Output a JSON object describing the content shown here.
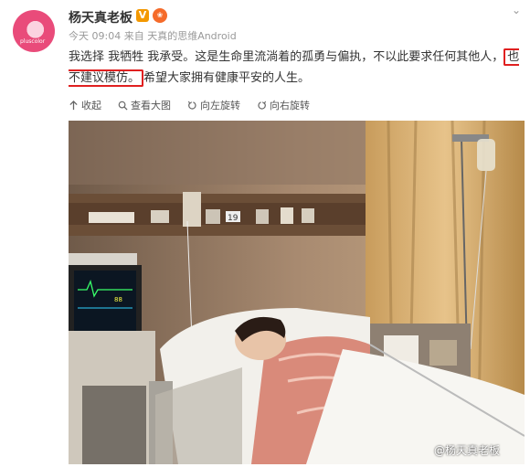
{
  "post": {
    "username": "杨天真老板",
    "vip_badge": "V",
    "meta": "今天 09:04 来自 天真的思维Android",
    "text_before": "我选择 我牺牲 我承受。这是生命里流淌着的孤勇与偏执，不以此要求任何其他人，",
    "text_highlight": "也不建议模仿。",
    "text_after": "希望大家拥有健康平安的人生。",
    "avatar_label": "pluscolor"
  },
  "toolbar": {
    "collapse": "收起",
    "view_large": "查看大图",
    "rotate_left": "向左旋转",
    "rotate_right": "向右旋转"
  },
  "photo": {
    "watermark": "@杨天真老板",
    "room_number": "19"
  },
  "colors": {
    "highlight_border": "#e02020",
    "vip_badge": "#f39800",
    "avatar": "#e94b7a"
  }
}
